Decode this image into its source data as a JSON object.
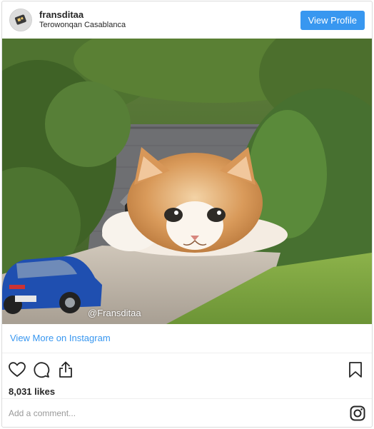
{
  "header": {
    "username": "fransditaa",
    "location": "Terowonqan Casablanca",
    "view_profile_label": "View Profile"
  },
  "photo": {
    "watermark": "@Fransditaa",
    "subject": "giant-cat-in-tunnel"
  },
  "links": {
    "view_more": "View More on Instagram"
  },
  "actions": {
    "icons": [
      "heart-icon",
      "comment-icon",
      "share-icon",
      "bookmark-icon"
    ]
  },
  "likes": {
    "text": "8,031 likes"
  },
  "comment": {
    "placeholder": "Add a comment..."
  },
  "colors": {
    "accent": "#3897f0",
    "text": "#262626",
    "muted": "#999999",
    "border": "#dbdbdb"
  }
}
